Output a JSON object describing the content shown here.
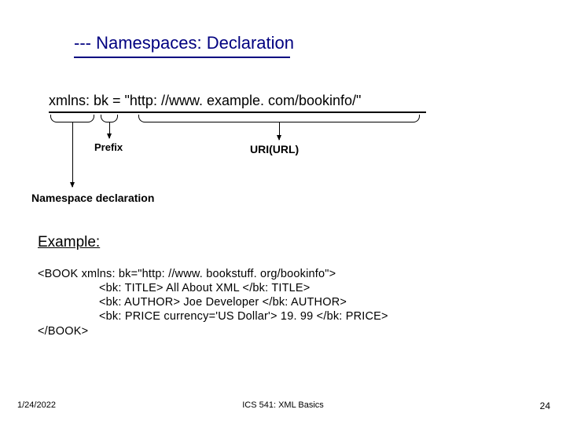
{
  "title": "--- Namespaces: Declaration",
  "declaration_line": "xmlns: bk = \"http: //www. example. com/bookinfo/\"",
  "labels": {
    "prefix": "Prefix",
    "uri": "URI(URL)",
    "nsdecl": "Namespace declaration",
    "example": "Example:"
  },
  "code": {
    "l1": "<BOOK  xmlns: bk=\"http: //www. bookstuff. org/bookinfo\">",
    "l2": "<bk: TITLE>  All About XML   </bk: TITLE>",
    "l3": "<bk: AUTHOR> Joe Developer    </bk: AUTHOR>",
    "l4": "<bk: PRICE  currency='US Dollar'> 19. 99  </bk: PRICE>",
    "l5": "</BOOK>"
  },
  "footer": {
    "date": "1/24/2022",
    "center": "ICS 541: XML Basics",
    "page": "24"
  }
}
